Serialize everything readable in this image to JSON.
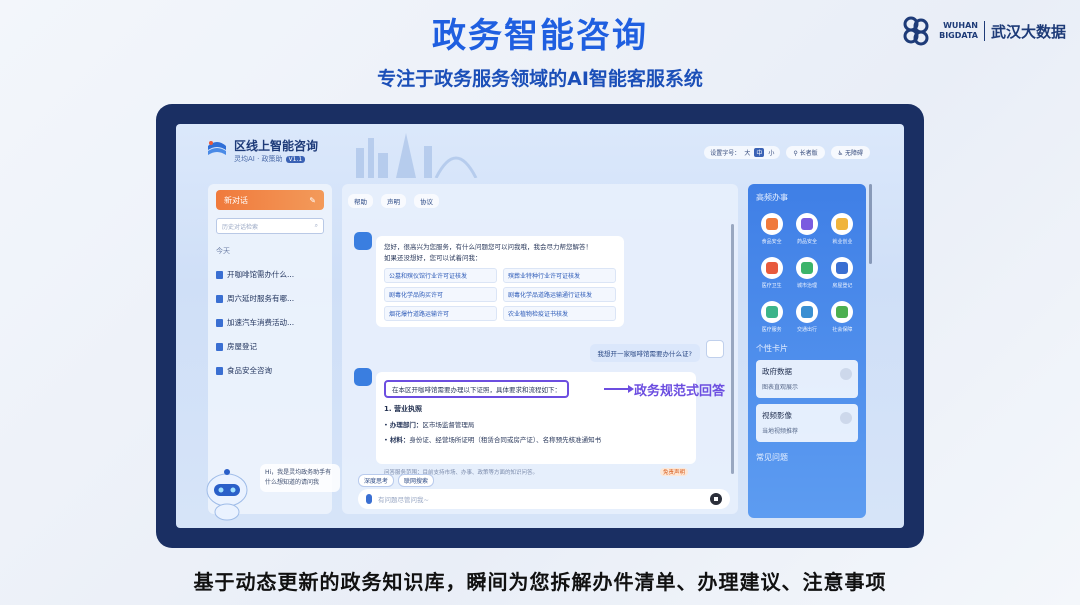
{
  "slide": {
    "title": "政务智能咨询",
    "subtitle": "专注于政务服务领域的AI智能客服系统",
    "caption": "基于动态更新的政务知识库，瞬间为您拆解办件清单、办理建议、注意事项",
    "brand_top": "WUHAN",
    "brand_bottom": "BIGDATA",
    "brand_cn": "武汉大数据"
  },
  "app": {
    "title": "区线上智能咨询",
    "subtitle": "灵均AI · 政策助",
    "version": "V1.1",
    "font_label": "设置字号：",
    "font_options": [
      "大",
      "中",
      "小"
    ],
    "font_selected": "中",
    "elder_mode": "长者版",
    "barrier_free": "无障碍"
  },
  "sidebar": {
    "new_chat": "新对话",
    "search_placeholder": "历史对话检索",
    "history_label": "今天",
    "history": [
      "开咖啡馆需办什么...",
      "周六延时服务有哪...",
      "加速汽车消费活动...",
      "房屋登记",
      "食品安全咨询"
    ]
  },
  "assistant_bubble": "Hi，我是灵均政务助手有什么想知道的请问我",
  "chat": {
    "tabs": [
      "帮助",
      "声明",
      "协议"
    ],
    "greeting": "您好，很高兴为您服务，有什么问题您可以问我哦，我会尽力帮您解答！",
    "prompt": "如果还没想好，您可以试着问我：",
    "suggestions": [
      "公墓和殡仪馆行业许可证核发",
      "殡葬业特种行业许可证核发",
      "剧毒化学品购买许可",
      "剧毒化学品道路运输通行证核发",
      "烟花爆竹道路运输许可",
      "农业植物检疫证书核发"
    ],
    "user_question": "我想开一家咖啡馆需要办什么证?",
    "answer_intro": "在本区开咖啡馆需要办理以下证照，具体要求和流程如下：",
    "answer_label": "政务规范式回答",
    "answer_heading": "1. 营业执照",
    "answer_lines": [
      {
        "k": "办理部门：",
        "v": "区市场监督管理局"
      },
      {
        "k": "材料：",
        "v": "身份证、经营场所证明（租赁合同或房产证）、名称预先核准通知书"
      }
    ],
    "answer_footer": "问答服务范围：目前支持市场、办事、政策等方面的知识问答。",
    "feedback": "免责声明",
    "quick_buttons": [
      "深度思考",
      "联网搜索"
    ],
    "input_placeholder": "有问题尽管问我~"
  },
  "right_panel": {
    "heading": "高频办事",
    "services": [
      {
        "label": "食品安全",
        "color": "#f07a3c"
      },
      {
        "label": "药品安全",
        "color": "#7a5be0"
      },
      {
        "label": "就业创业",
        "color": "#f0b43c"
      },
      {
        "label": "医疗卫生",
        "color": "#e85a3c"
      },
      {
        "label": "城市治理",
        "color": "#3cb46a"
      },
      {
        "label": "房屋登记",
        "color": "#3a6fd2"
      },
      {
        "label": "医疗服务",
        "color": "#3cb48a"
      },
      {
        "label": "交通出行",
        "color": "#3a8fd2"
      },
      {
        "label": "社会保障",
        "color": "#4caf50"
      }
    ],
    "cards_heading": "个性卡片",
    "cards": [
      {
        "title": "政府数据",
        "sub": "图表直观展示"
      },
      {
        "title": "视频影像",
        "sub": "当地视频推荐"
      }
    ],
    "faq_heading": "常见问题"
  }
}
